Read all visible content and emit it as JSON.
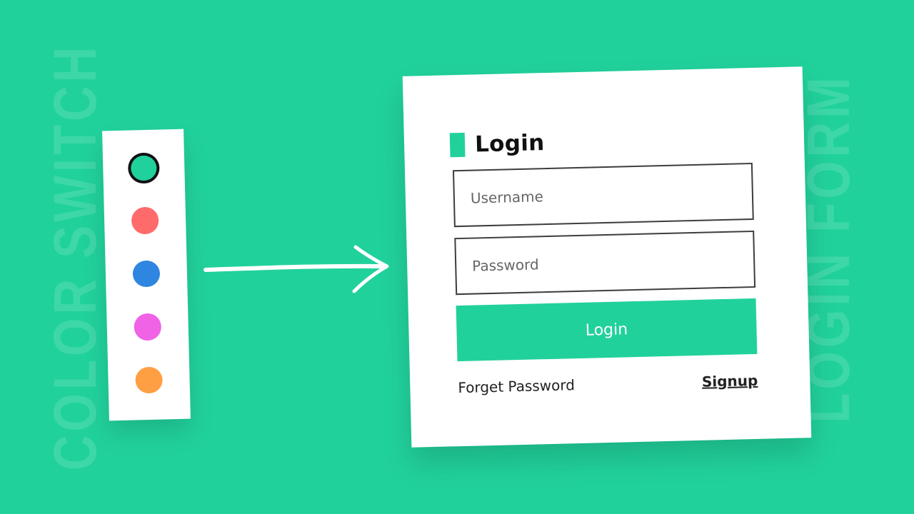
{
  "background": {
    "color": "#21D19C",
    "left_word": "COLOR SWITCH",
    "right_word": "LOGIN FORM"
  },
  "color_switch": {
    "swatches": [
      {
        "color": "#21D19C",
        "active": true
      },
      {
        "color": "#FF6B6B",
        "active": false
      },
      {
        "color": "#2F86E0",
        "active": false
      },
      {
        "color": "#F062E6",
        "active": false
      },
      {
        "color": "#FF9F43",
        "active": false
      }
    ]
  },
  "login_form": {
    "title": "Login",
    "username_placeholder": "Username",
    "password_placeholder": "Password",
    "submit_label": "Login",
    "forget_label": "Forget Password",
    "signup_label": "Signup",
    "accent_color": "#21D19C"
  }
}
